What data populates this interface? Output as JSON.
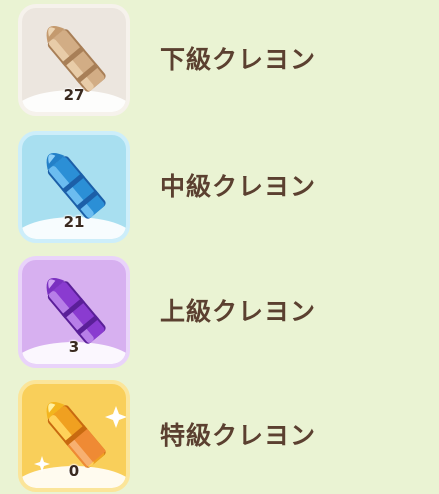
{
  "items": [
    {
      "name": "下級クレヨン",
      "count": "27",
      "icon": "crayon-brown-icon",
      "tile_color": "#ece6df",
      "crayon_color": "#c9a27a"
    },
    {
      "name": "中級クレヨン",
      "count": "21",
      "icon": "crayon-blue-icon",
      "tile_color": "#a8dff0",
      "crayon_color": "#2b8fd6"
    },
    {
      "name": "上級クレヨン",
      "count": "3",
      "icon": "crayon-purple-icon",
      "tile_color": "#d7b0f0",
      "crayon_color": "#8a3bd0"
    },
    {
      "name": "特級クレヨン",
      "count": "0",
      "icon": "crayon-gold-icon",
      "tile_color": "#f9cf5a",
      "crayon_color": "#f0a020"
    }
  ]
}
